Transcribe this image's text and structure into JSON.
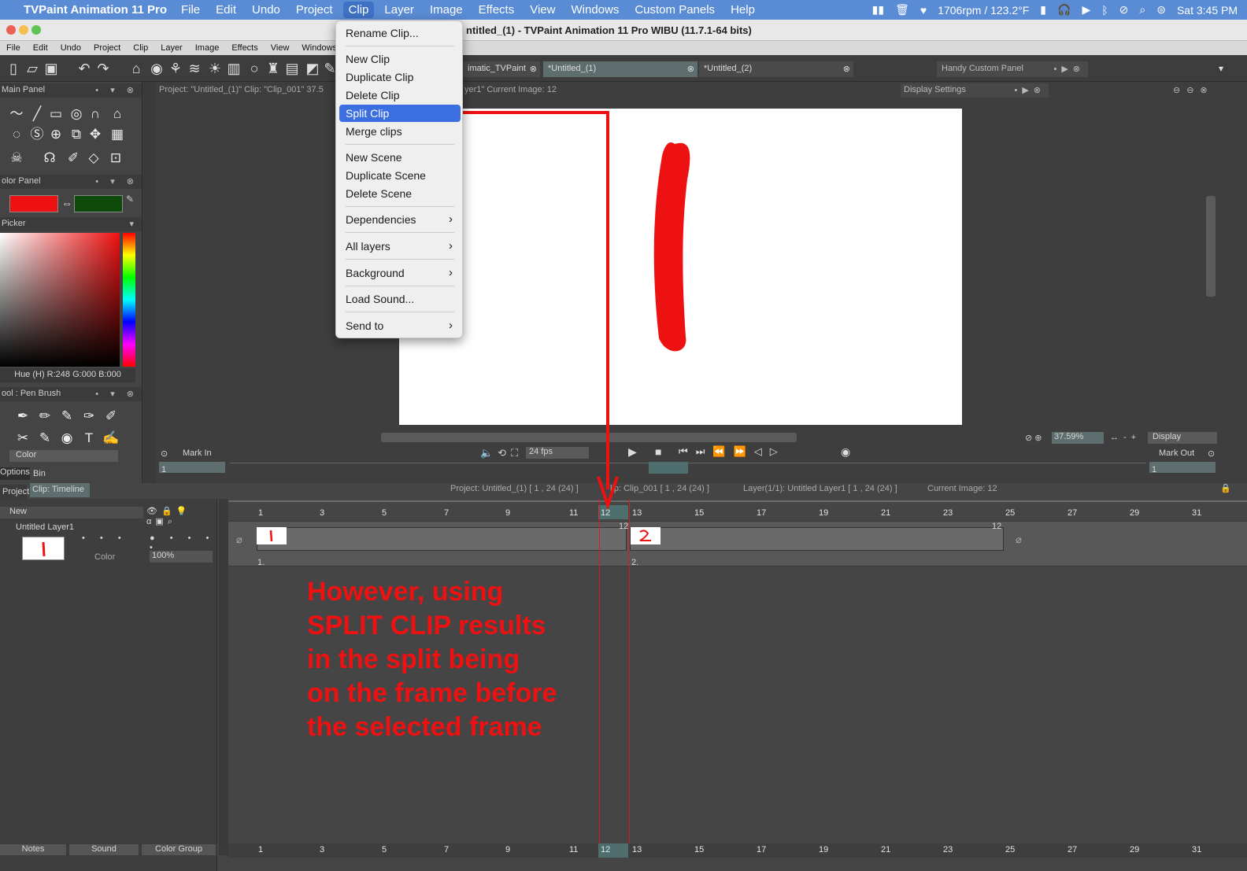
{
  "menubar": {
    "app_name": "TVPaint Animation 11 Pro",
    "items": [
      "File",
      "Edit",
      "Undo",
      "Project",
      "Clip",
      "Layer",
      "Image",
      "Effects",
      "View",
      "Windows",
      "Custom Panels",
      "Help"
    ],
    "status": "1706rpm / 123.2°F",
    "clock": "Sat  3:45 PM"
  },
  "window": {
    "title": "ntitled_(1) - TVPaint Animation 11 Pro WIBU (11.7.1-64 bits)"
  },
  "app_menu": [
    "File",
    "Edit",
    "Undo",
    "Project",
    "Clip",
    "Layer",
    "Image",
    "Effects",
    "View",
    "Windows"
  ],
  "tabs": [
    {
      "label": "imatic_TVPaint"
    },
    {
      "label": "*Untitled_(1)"
    },
    {
      "label": "*Untitled_(2)"
    }
  ],
  "handy_panel": "Handy Custom Panel",
  "display_settings": "Display Settings",
  "viewport": {
    "info_left": "Project: \"Untitled_(1)\"  Clip: \"Clip_001\"  37.5",
    "info_right": "yer1\"  Current Image: 12",
    "zoom": "37.59%",
    "display": "Display"
  },
  "clip_menu": {
    "items": [
      {
        "label": "Rename Clip..."
      },
      {
        "label": "New Clip"
      },
      {
        "label": "Duplicate Clip"
      },
      {
        "label": "Delete Clip"
      },
      {
        "label": "Split Clip",
        "selected": true
      },
      {
        "label": "Merge clips"
      },
      {
        "label": "New Scene"
      },
      {
        "label": "Duplicate Scene"
      },
      {
        "label": "Delete Scene"
      },
      {
        "label": "Dependencies",
        "submenu": true
      },
      {
        "label": "All layers",
        "submenu": true
      },
      {
        "label": "Background",
        "submenu": true
      },
      {
        "label": "Load Sound...",
        "submenu": false
      },
      {
        "label": "Send to",
        "submenu": true
      }
    ]
  },
  "left_panels": {
    "main_panel": "Main Panel",
    "color_panel": "olor Panel",
    "picker": "Picker",
    "hue_readout": "Hue (H) R:248 G:000 B:000",
    "tool_panel": "ool : Pen Brush",
    "color_label": "Color",
    "options_tab": "Options",
    "bin_tab": "Bin",
    "colors": {
      "primary": "#ee1111",
      "secondary": "#0e4a0a"
    }
  },
  "transport": {
    "mark_in": "Mark In",
    "fps": "24 fps",
    "mark_out": "Mark Out",
    "in_value": "1",
    "out_value": "1"
  },
  "timeline": {
    "tabs": [
      "Project",
      "Clip: Timeline"
    ],
    "info": {
      "project": "Project: Untitled_(1) [ 1 , 24  (24) ]",
      "clip": "lip: Clip_001 [ 1 , 24  (24) ]",
      "layer": "Layer(1/1): Untitled Layer1 [ 1 , 24  (24) ]",
      "current": "Current Image: 12"
    },
    "new_label": "New",
    "layer_name": "Untitled Layer1",
    "layer_color": "Color",
    "opacity": "100%",
    "ruler": [
      "1",
      "3",
      "5",
      "7",
      "9",
      "11",
      "12",
      "13",
      "15",
      "17",
      "19",
      "21",
      "23",
      "25",
      "27",
      "29",
      "31"
    ],
    "clip1_marker": "1.",
    "clip2_marker": "2.",
    "clip_end_1": "12",
    "clip_end_2": "12",
    "bottom_tabs": [
      "Notes",
      "Sound",
      "Color Group"
    ]
  },
  "annotation": {
    "lines": [
      "However, using",
      "SPLIT CLIP results",
      "in the split being",
      "on the frame before",
      "the selected frame"
    ]
  }
}
